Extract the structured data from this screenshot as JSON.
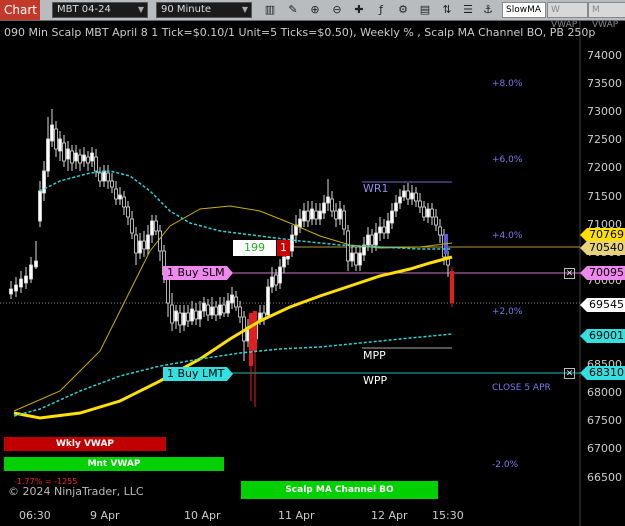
{
  "toolbar": {
    "chart_tab": "Chart",
    "instrument": "MBT 04-24",
    "interval": "90 Minute",
    "slowma": "SlowMA",
    "btn1": "W VWAP",
    "btn2": "M VWAP"
  },
  "title": "090 Min Scalp MBT April 8 1 Tick=$0.10/1 Unit=5 Ticks=$0.50), Weekly % , Scalp MA Channel BO, PB 250p",
  "price_axis": [
    "74000",
    "73500",
    "73000",
    "72500",
    "72000",
    "71500",
    "71000",
    "70500",
    "70000",
    "69500",
    "69000",
    "68500",
    "68000",
    "67500",
    "67000",
    "66500"
  ],
  "pct_labels": [
    "+8.0%",
    "+6,0%",
    "+4.0%",
    "+2,0%",
    "-2.0%"
  ],
  "close_label": "CLOSE 5 APR",
  "time_axis": [
    "06:30",
    "9 Apr",
    "10 Apr",
    "11 Apr",
    "12 Apr",
    "15:30"
  ],
  "price_flags": {
    "f1": "70769",
    "f2": "70540",
    "f3": "70095",
    "f4": "69545",
    "f5": "69001",
    "f6": "68310"
  },
  "levels": {
    "wr1": "WR1",
    "mpp": "MPP",
    "wpp": "WPP"
  },
  "orders": {
    "buy_slm": "1 Buy SLM",
    "buy_lmt": "1 Buy LMT",
    "qty": "199",
    "qty_n": "1",
    "close_x": "✕"
  },
  "bars": {
    "wkly": "Wkly VWAP",
    "mnt": "Mnt VWAP",
    "scalp": "Scalp MA Channel BO"
  },
  "pnl_small": "-1.77% = -1255",
  "copyright": "© 2024 NinjaTrader, LLC",
  "colors": {
    "up": "#ffffff",
    "down": "#ffffff",
    "slowma": "#ffe000",
    "cyan": "#2ad4d4",
    "olive": "#c8b000",
    "accent": "#c0392b"
  }
}
